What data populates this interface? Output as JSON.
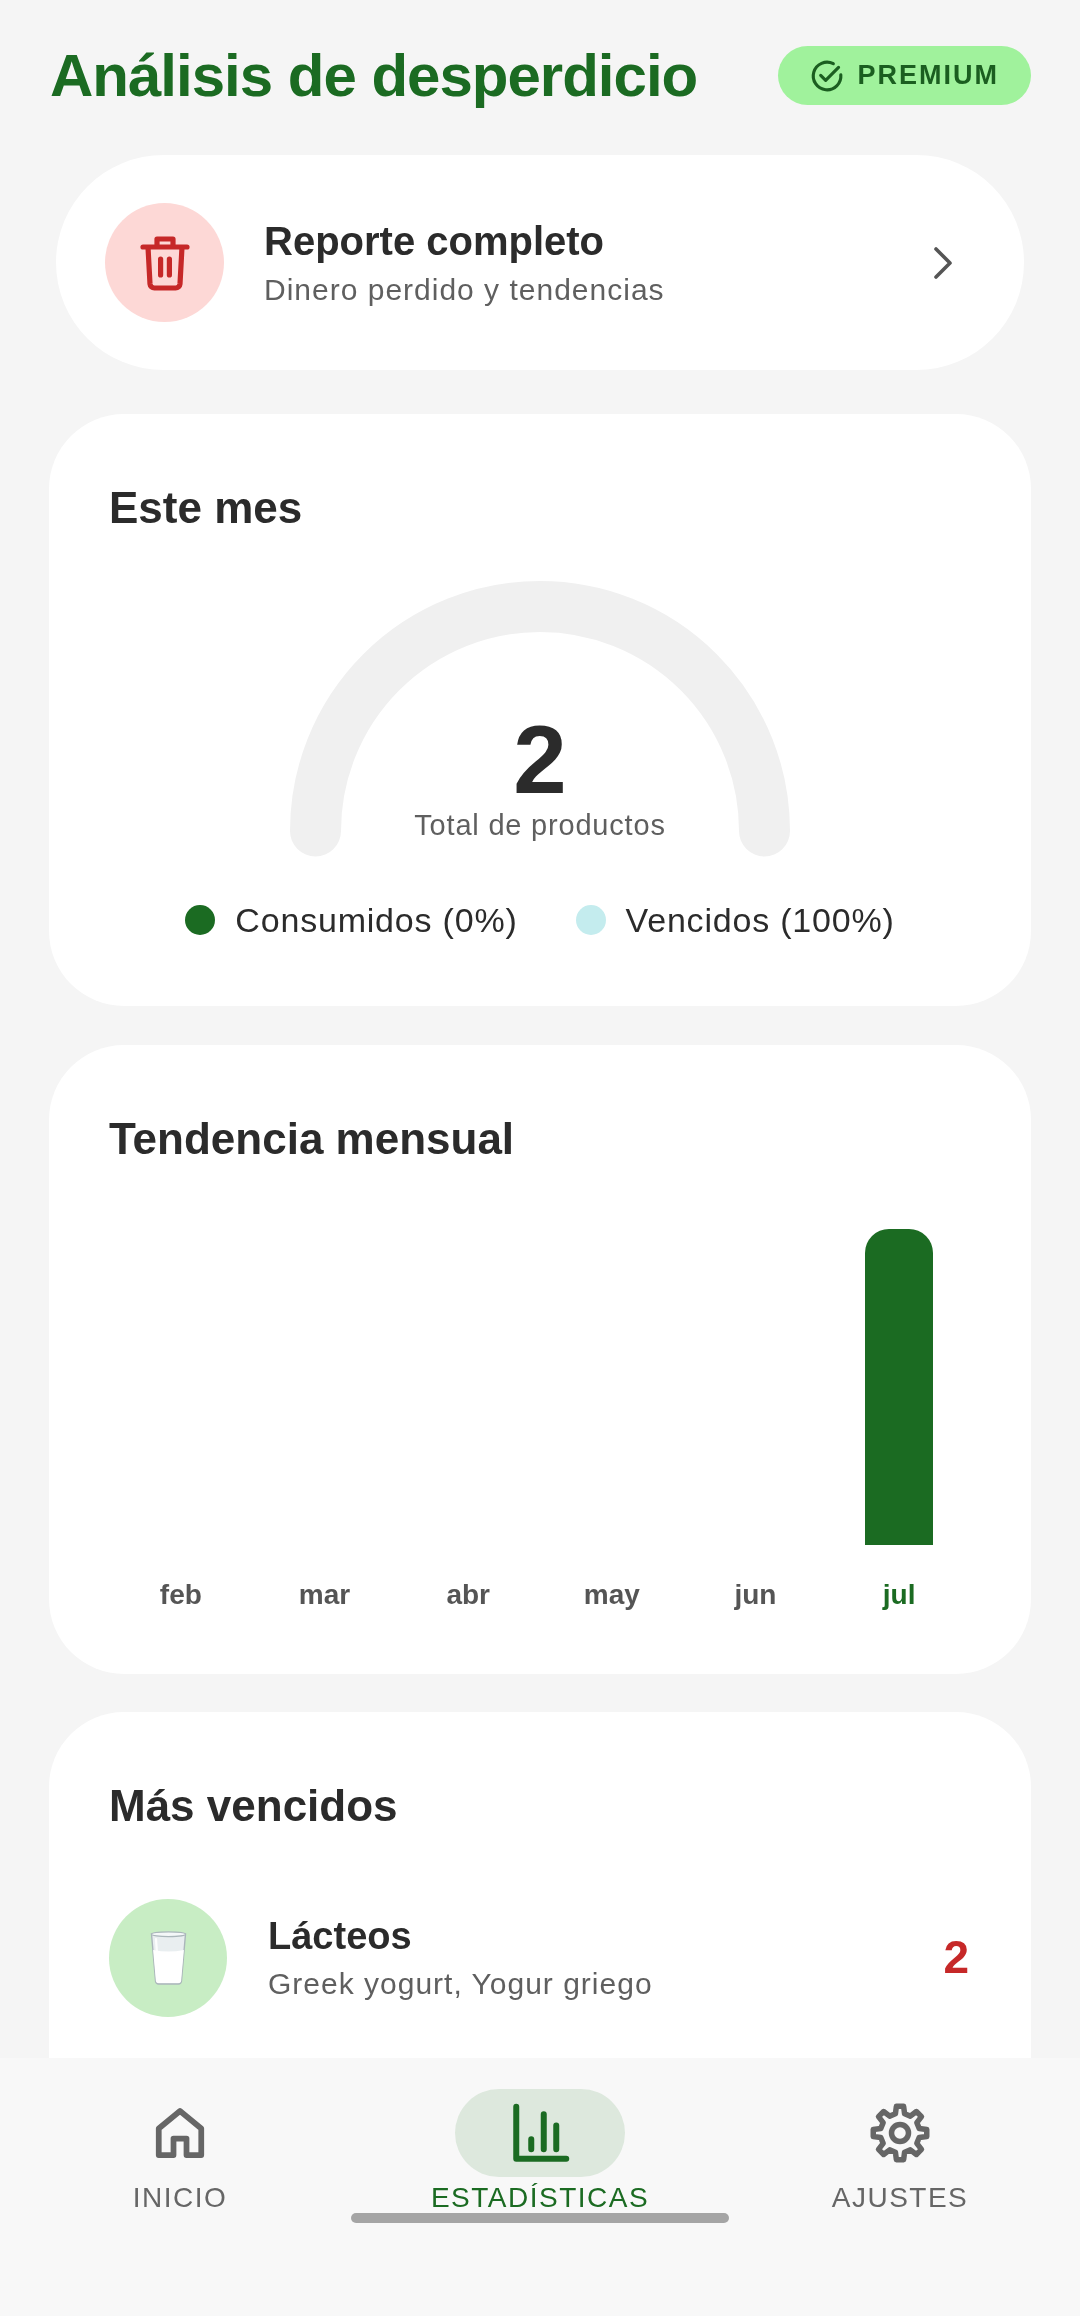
{
  "header": {
    "title": "Análisis de desperdicio",
    "badge": "PREMIUM"
  },
  "report_card": {
    "title": "Reporte completo",
    "subtitle": "Dinero perdido y tendencias"
  },
  "this_month": {
    "title": "Este mes",
    "total": "2",
    "total_label": "Total de productos",
    "legend": [
      {
        "label": "Consumidos (0%)",
        "color": "#1b6b22"
      },
      {
        "label": "Vencidos (100%)",
        "color": "#c4ecee"
      }
    ]
  },
  "monthly_trend": {
    "title": "Tendencia mensual",
    "months": [
      {
        "label": "feb",
        "selected": false
      },
      {
        "label": "mar",
        "selected": false
      },
      {
        "label": "abr",
        "selected": false
      },
      {
        "label": "may",
        "selected": false
      },
      {
        "label": "jun",
        "selected": false
      },
      {
        "label": "jul",
        "selected": true
      }
    ]
  },
  "most_expired": {
    "title": "Más vencidos",
    "items": [
      {
        "name": "Lácteos",
        "products": "Greek yogurt, Yogur griego",
        "count": "2"
      }
    ]
  },
  "bottom_nav": [
    {
      "kind": "home",
      "label": "INICIO",
      "selected": false
    },
    {
      "kind": "stats",
      "label": "ESTADÍSTICAS",
      "selected": true
    },
    {
      "kind": "settings",
      "label": "AJUSTES",
      "selected": false
    }
  ]
}
